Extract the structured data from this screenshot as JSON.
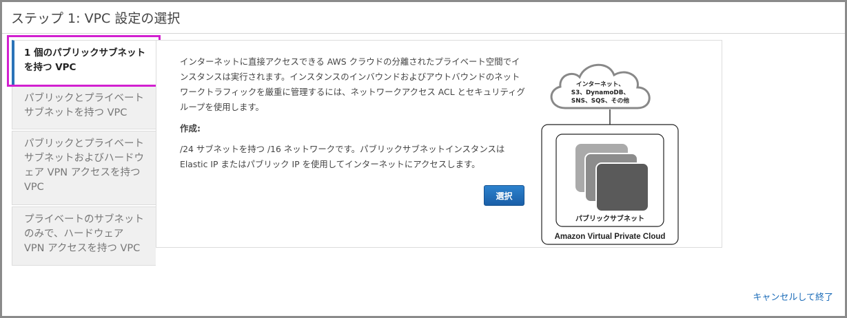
{
  "header": {
    "title": "ステップ 1: VPC 設定の選択"
  },
  "sidebar": {
    "items": [
      {
        "label": "1 個のパブリックサブネットを持つ VPC",
        "active": true
      },
      {
        "label": "パブリックとプライベートサブネットを持つ VPC",
        "active": false
      },
      {
        "label": "パブリックとプライベートサブネットおよびハードウェア VPN アクセスを持つ VPC",
        "active": false
      },
      {
        "label": "プライベートのサブネットのみで、ハードウェア VPN アクセスを持つ VPC",
        "active": false
      }
    ]
  },
  "main": {
    "description": "インターネットに直接アクセスできる AWS クラウドの分離されたプライベート空間でインスタンスは実行されます。インスタンスのインバウンドおよびアウトバウンドのネットワークトラフィックを厳重に管理するには、ネットワークアクセス ACL とセキュリティグループを使用します。",
    "create_label": "作成:",
    "create_text": "/24 サブネットを持つ /16 ネットワークです。パブリックサブネットインスタンスは Elastic IP またはパブリック IP を使用してインターネットにアクセスします。",
    "select_button": "選択"
  },
  "diagram": {
    "cloud_lines": [
      "インターネット、",
      "S3、DynamoDB、",
      "SNS、SQS、その他"
    ],
    "subnet_label": "パブリックサブネット",
    "vpc_label": "Amazon Virtual Private Cloud"
  },
  "footer": {
    "cancel_link": "キャンセルして終了"
  },
  "colors": {
    "highlight": "#d21fd0",
    "active_bar": "#2a73b8",
    "button": "#1f6bb5",
    "link": "#1a6bb8"
  }
}
